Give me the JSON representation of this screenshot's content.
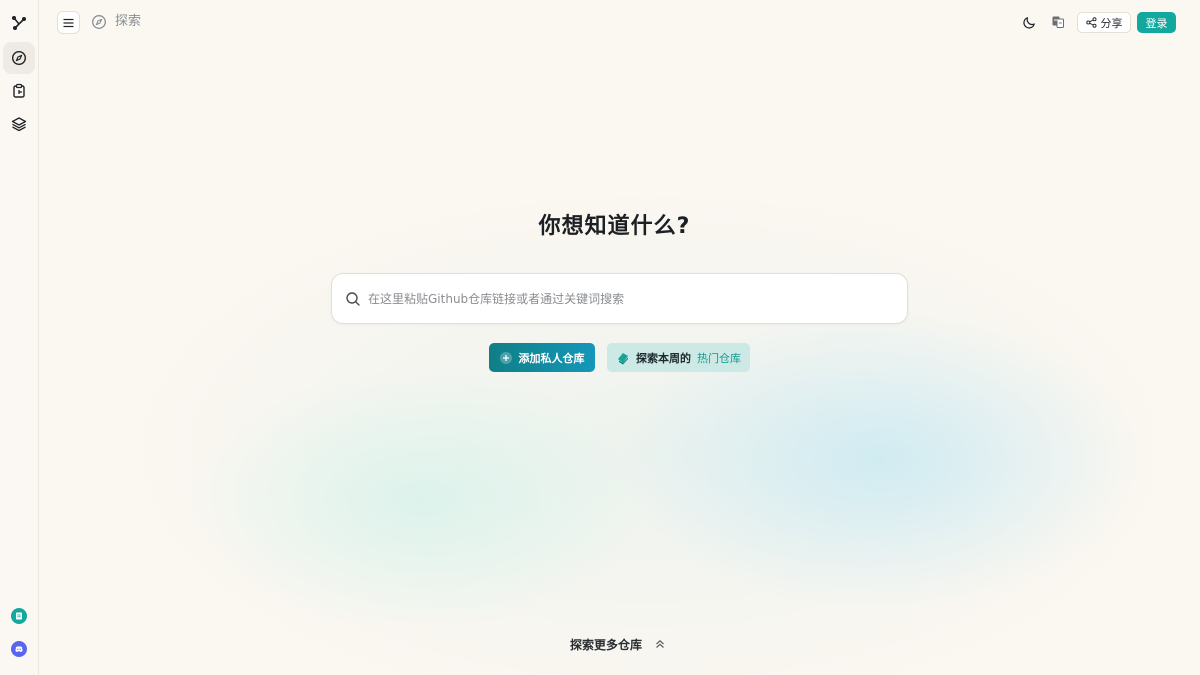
{
  "header": {
    "breadcrumb": "探索",
    "share_label": "分享",
    "login_label": "登录"
  },
  "hero": {
    "title": "你想知道什么?",
    "search_placeholder": "在这里粘贴Github仓库链接或者通过关键词搜索",
    "search_value": ""
  },
  "actions": {
    "add_private_repo": "添加私人仓库",
    "explore_week": "探索本周的",
    "hot_repos": "热门仓库"
  },
  "footer": {
    "more_repos": "探索更多仓库"
  },
  "colors": {
    "accent": "#13a89e",
    "background": "#fbf7f1",
    "discord": "#5865f2"
  },
  "icons": {
    "logo": "graph-logo-icon",
    "explore": "compass-icon",
    "repo": "clipboard-icon",
    "layers": "layers-icon",
    "docs": "document-icon",
    "community": "discord-icon",
    "theme": "moon-icon",
    "language": "translate-icon"
  }
}
